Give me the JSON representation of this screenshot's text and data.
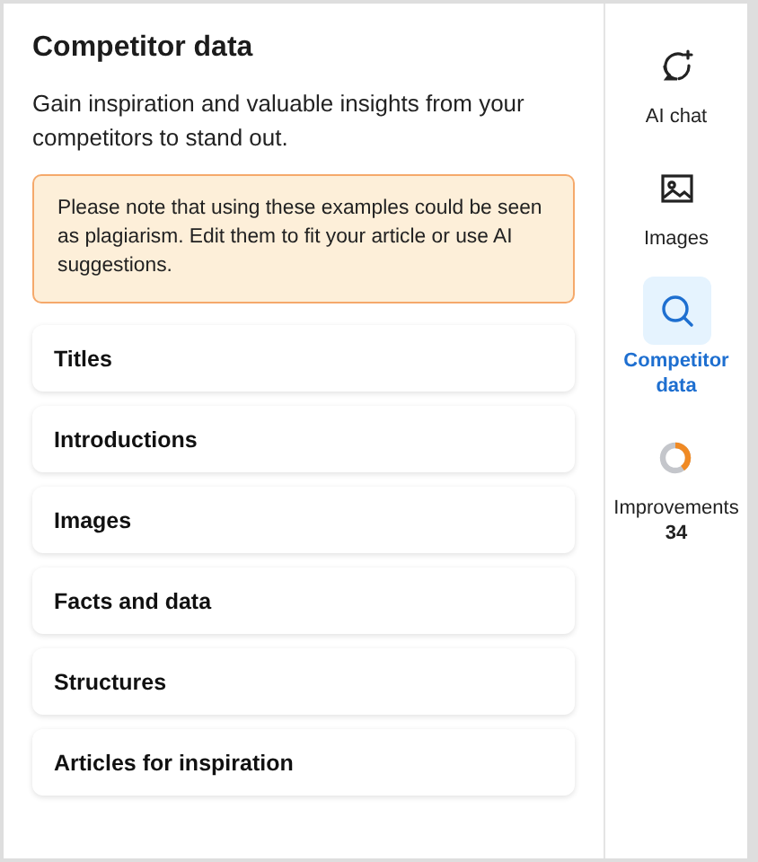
{
  "panel": {
    "title": "Competitor data",
    "description": "Gain inspiration and valuable insights from your competitors to stand out.",
    "notice": "Please note that using these examples could be seen as plagiarism. Edit them to fit your article or use AI suggestions.",
    "sections": [
      {
        "label": "Titles"
      },
      {
        "label": "Introductions"
      },
      {
        "label": "Images"
      },
      {
        "label": "Facts and data"
      },
      {
        "label": "Structures"
      },
      {
        "label": "Articles for inspiration"
      }
    ]
  },
  "sidebar": {
    "items": [
      {
        "kind": "chat",
        "label": "AI chat",
        "selected": false
      },
      {
        "kind": "images",
        "label": "Images",
        "selected": false
      },
      {
        "kind": "search",
        "label": "Competitor data",
        "selected": true
      },
      {
        "kind": "progress",
        "label": "Improvements",
        "count": "34",
        "level": 0.4,
        "selected": false
      }
    ]
  }
}
